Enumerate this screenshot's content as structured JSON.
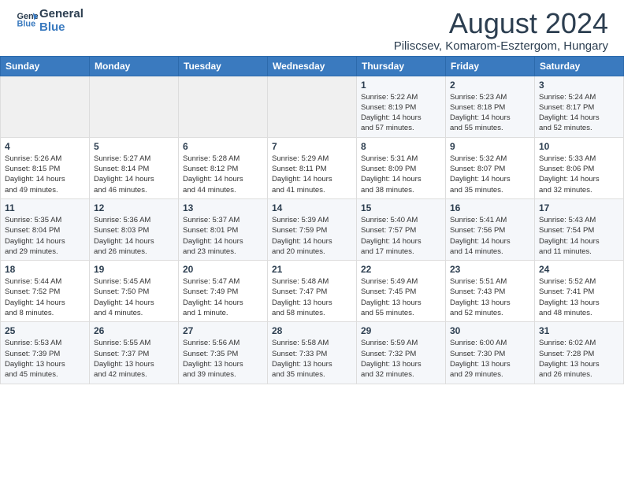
{
  "header": {
    "logo_line1": "General",
    "logo_line2": "Blue",
    "month_year": "August 2024",
    "location": "Piliscsev, Komarom-Esztergom, Hungary"
  },
  "weekdays": [
    "Sunday",
    "Monday",
    "Tuesday",
    "Wednesday",
    "Thursday",
    "Friday",
    "Saturday"
  ],
  "weeks": [
    [
      {
        "day": "",
        "detail": ""
      },
      {
        "day": "",
        "detail": ""
      },
      {
        "day": "",
        "detail": ""
      },
      {
        "day": "",
        "detail": ""
      },
      {
        "day": "1",
        "detail": "Sunrise: 5:22 AM\nSunset: 8:19 PM\nDaylight: 14 hours\nand 57 minutes."
      },
      {
        "day": "2",
        "detail": "Sunrise: 5:23 AM\nSunset: 8:18 PM\nDaylight: 14 hours\nand 55 minutes."
      },
      {
        "day": "3",
        "detail": "Sunrise: 5:24 AM\nSunset: 8:17 PM\nDaylight: 14 hours\nand 52 minutes."
      }
    ],
    [
      {
        "day": "4",
        "detail": "Sunrise: 5:26 AM\nSunset: 8:15 PM\nDaylight: 14 hours\nand 49 minutes."
      },
      {
        "day": "5",
        "detail": "Sunrise: 5:27 AM\nSunset: 8:14 PM\nDaylight: 14 hours\nand 46 minutes."
      },
      {
        "day": "6",
        "detail": "Sunrise: 5:28 AM\nSunset: 8:12 PM\nDaylight: 14 hours\nand 44 minutes."
      },
      {
        "day": "7",
        "detail": "Sunrise: 5:29 AM\nSunset: 8:11 PM\nDaylight: 14 hours\nand 41 minutes."
      },
      {
        "day": "8",
        "detail": "Sunrise: 5:31 AM\nSunset: 8:09 PM\nDaylight: 14 hours\nand 38 minutes."
      },
      {
        "day": "9",
        "detail": "Sunrise: 5:32 AM\nSunset: 8:07 PM\nDaylight: 14 hours\nand 35 minutes."
      },
      {
        "day": "10",
        "detail": "Sunrise: 5:33 AM\nSunset: 8:06 PM\nDaylight: 14 hours\nand 32 minutes."
      }
    ],
    [
      {
        "day": "11",
        "detail": "Sunrise: 5:35 AM\nSunset: 8:04 PM\nDaylight: 14 hours\nand 29 minutes."
      },
      {
        "day": "12",
        "detail": "Sunrise: 5:36 AM\nSunset: 8:03 PM\nDaylight: 14 hours\nand 26 minutes."
      },
      {
        "day": "13",
        "detail": "Sunrise: 5:37 AM\nSunset: 8:01 PM\nDaylight: 14 hours\nand 23 minutes."
      },
      {
        "day": "14",
        "detail": "Sunrise: 5:39 AM\nSunset: 7:59 PM\nDaylight: 14 hours\nand 20 minutes."
      },
      {
        "day": "15",
        "detail": "Sunrise: 5:40 AM\nSunset: 7:57 PM\nDaylight: 14 hours\nand 17 minutes."
      },
      {
        "day": "16",
        "detail": "Sunrise: 5:41 AM\nSunset: 7:56 PM\nDaylight: 14 hours\nand 14 minutes."
      },
      {
        "day": "17",
        "detail": "Sunrise: 5:43 AM\nSunset: 7:54 PM\nDaylight: 14 hours\nand 11 minutes."
      }
    ],
    [
      {
        "day": "18",
        "detail": "Sunrise: 5:44 AM\nSunset: 7:52 PM\nDaylight: 14 hours\nand 8 minutes."
      },
      {
        "day": "19",
        "detail": "Sunrise: 5:45 AM\nSunset: 7:50 PM\nDaylight: 14 hours\nand 4 minutes."
      },
      {
        "day": "20",
        "detail": "Sunrise: 5:47 AM\nSunset: 7:49 PM\nDaylight: 14 hours\nand 1 minute."
      },
      {
        "day": "21",
        "detail": "Sunrise: 5:48 AM\nSunset: 7:47 PM\nDaylight: 13 hours\nand 58 minutes."
      },
      {
        "day": "22",
        "detail": "Sunrise: 5:49 AM\nSunset: 7:45 PM\nDaylight: 13 hours\nand 55 minutes."
      },
      {
        "day": "23",
        "detail": "Sunrise: 5:51 AM\nSunset: 7:43 PM\nDaylight: 13 hours\nand 52 minutes."
      },
      {
        "day": "24",
        "detail": "Sunrise: 5:52 AM\nSunset: 7:41 PM\nDaylight: 13 hours\nand 48 minutes."
      }
    ],
    [
      {
        "day": "25",
        "detail": "Sunrise: 5:53 AM\nSunset: 7:39 PM\nDaylight: 13 hours\nand 45 minutes."
      },
      {
        "day": "26",
        "detail": "Sunrise: 5:55 AM\nSunset: 7:37 PM\nDaylight: 13 hours\nand 42 minutes."
      },
      {
        "day": "27",
        "detail": "Sunrise: 5:56 AM\nSunset: 7:35 PM\nDaylight: 13 hours\nand 39 minutes."
      },
      {
        "day": "28",
        "detail": "Sunrise: 5:58 AM\nSunset: 7:33 PM\nDaylight: 13 hours\nand 35 minutes."
      },
      {
        "day": "29",
        "detail": "Sunrise: 5:59 AM\nSunset: 7:32 PM\nDaylight: 13 hours\nand 32 minutes."
      },
      {
        "day": "30",
        "detail": "Sunrise: 6:00 AM\nSunset: 7:30 PM\nDaylight: 13 hours\nand 29 minutes."
      },
      {
        "day": "31",
        "detail": "Sunrise: 6:02 AM\nSunset: 7:28 PM\nDaylight: 13 hours\nand 26 minutes."
      }
    ]
  ]
}
